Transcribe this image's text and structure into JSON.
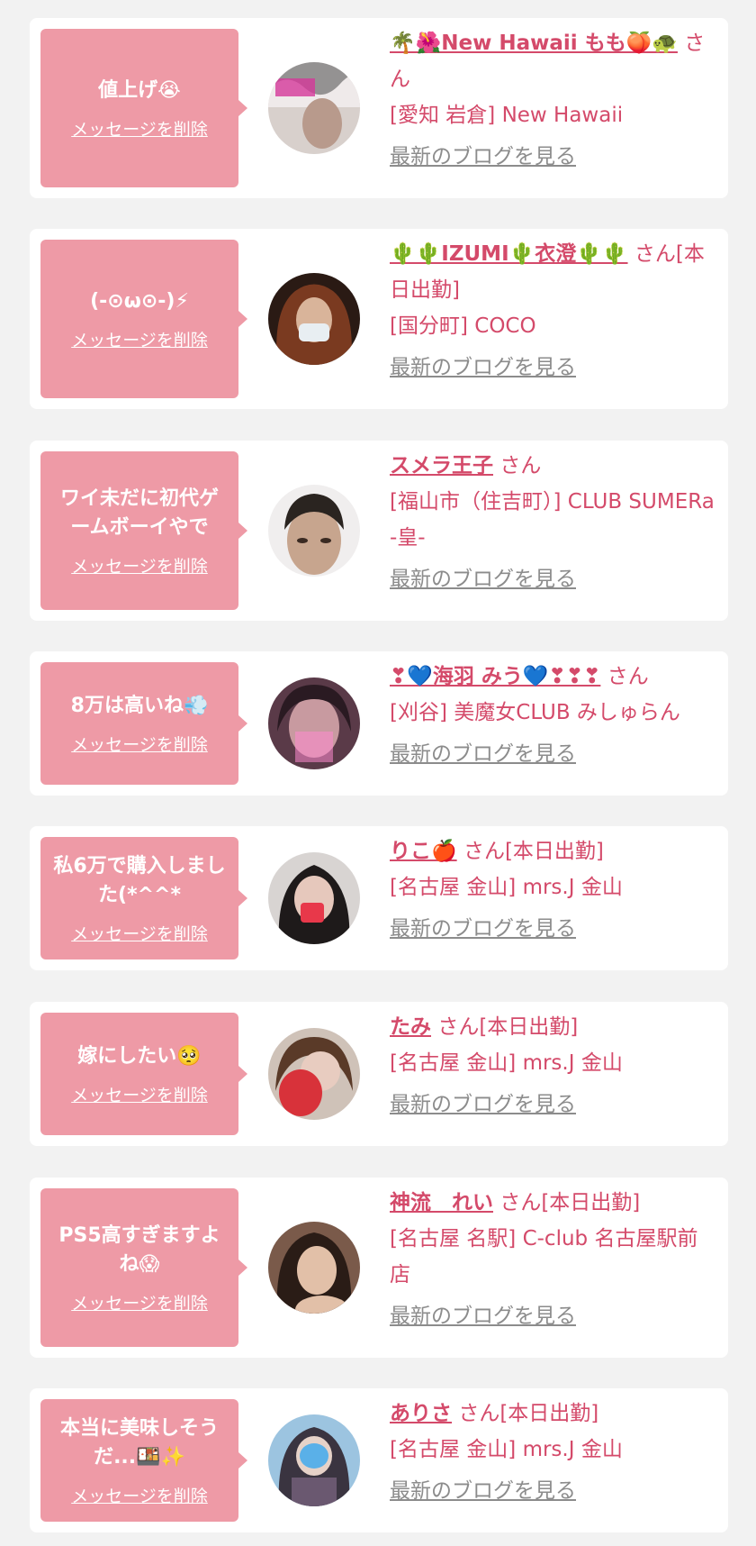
{
  "delete_label": "メッセージを削除",
  "blog_label": "最新のブログを見る",
  "san": "さん",
  "items": [
    {
      "message": "値上げ😭",
      "name": "🌴🌺New Hawaii もも🍑🐢",
      "status": "",
      "shop": "[愛知 岩倉] New Hawaii",
      "avatar_bg": "#9a8f8f"
    },
    {
      "message": "(-⊙ω⊙-)⚡",
      "name": "🌵🌵IZUMI🌵衣澄🌵🌵",
      "status": "[本日出勤]",
      "shop": "[国分町] COCO",
      "avatar_bg": "#5a3326"
    },
    {
      "message": "ワイ未だに初代ゲームボーイやで",
      "name": "スメラ王子",
      "status": "",
      "shop": "[福山市（住吉町）] CLUB SUMERa -皇-",
      "avatar_bg": "#4f3f37"
    },
    {
      "message": "8万は高いね💨",
      "name": "❣💙海羽 みう💙❣❣❣",
      "status": "",
      "shop": "[刈谷] 美魔女CLUB みしゅらん",
      "avatar_bg": "#8a4b63"
    },
    {
      "message": "私6万で購入しました(*^^*",
      "name": "りこ🍎",
      "status": "[本日出勤]",
      "shop": "[名古屋 金山] mrs.J 金山",
      "avatar_bg": "#6c5a55"
    },
    {
      "message": "嫁にしたい🥺",
      "name": "たみ",
      "status": "[本日出勤]",
      "shop": "[名古屋 金山] mrs.J 金山",
      "avatar_bg": "#7a5c48"
    },
    {
      "message": "PS5高すぎますよね😱",
      "name": "神流　れい",
      "status": "[本日出勤]",
      "shop": "[名古屋 名駅] C-club 名古屋駅前店",
      "avatar_bg": "#6b4a3f"
    },
    {
      "message": "本当に美味しそうだ...🍱✨",
      "name": "ありさ",
      "status": "[本日出勤]",
      "shop": "[名古屋 金山] mrs.J 金山",
      "avatar_bg": "#7aa6c8"
    }
  ]
}
